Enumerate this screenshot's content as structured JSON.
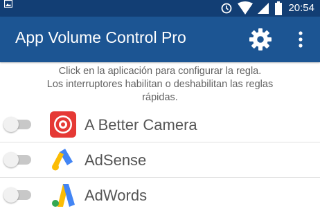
{
  "status_bar": {
    "time": "20:54",
    "icons": [
      "image-icon",
      "alarm-icon",
      "wifi-icon",
      "signal-icon",
      "battery-icon"
    ],
    "background": "#123e74"
  },
  "app_bar": {
    "title": "App Volume Control Pro",
    "background": "#1c5593",
    "actions": [
      "gear-icon",
      "more-vert-icon"
    ]
  },
  "hint": {
    "line1": "Click en la aplicación para configurar la regla.",
    "line2": "Los interruptores habilitan o deshabilitan las reglas",
    "line3": "rápidas."
  },
  "apps": [
    {
      "name": "A Better Camera",
      "icon": "camera-app-icon",
      "enabled": false
    },
    {
      "name": "AdSense",
      "icon": "adsense-app-icon",
      "enabled": false
    },
    {
      "name": "AdWords",
      "icon": "adwords-app-icon",
      "enabled": false
    }
  ]
}
